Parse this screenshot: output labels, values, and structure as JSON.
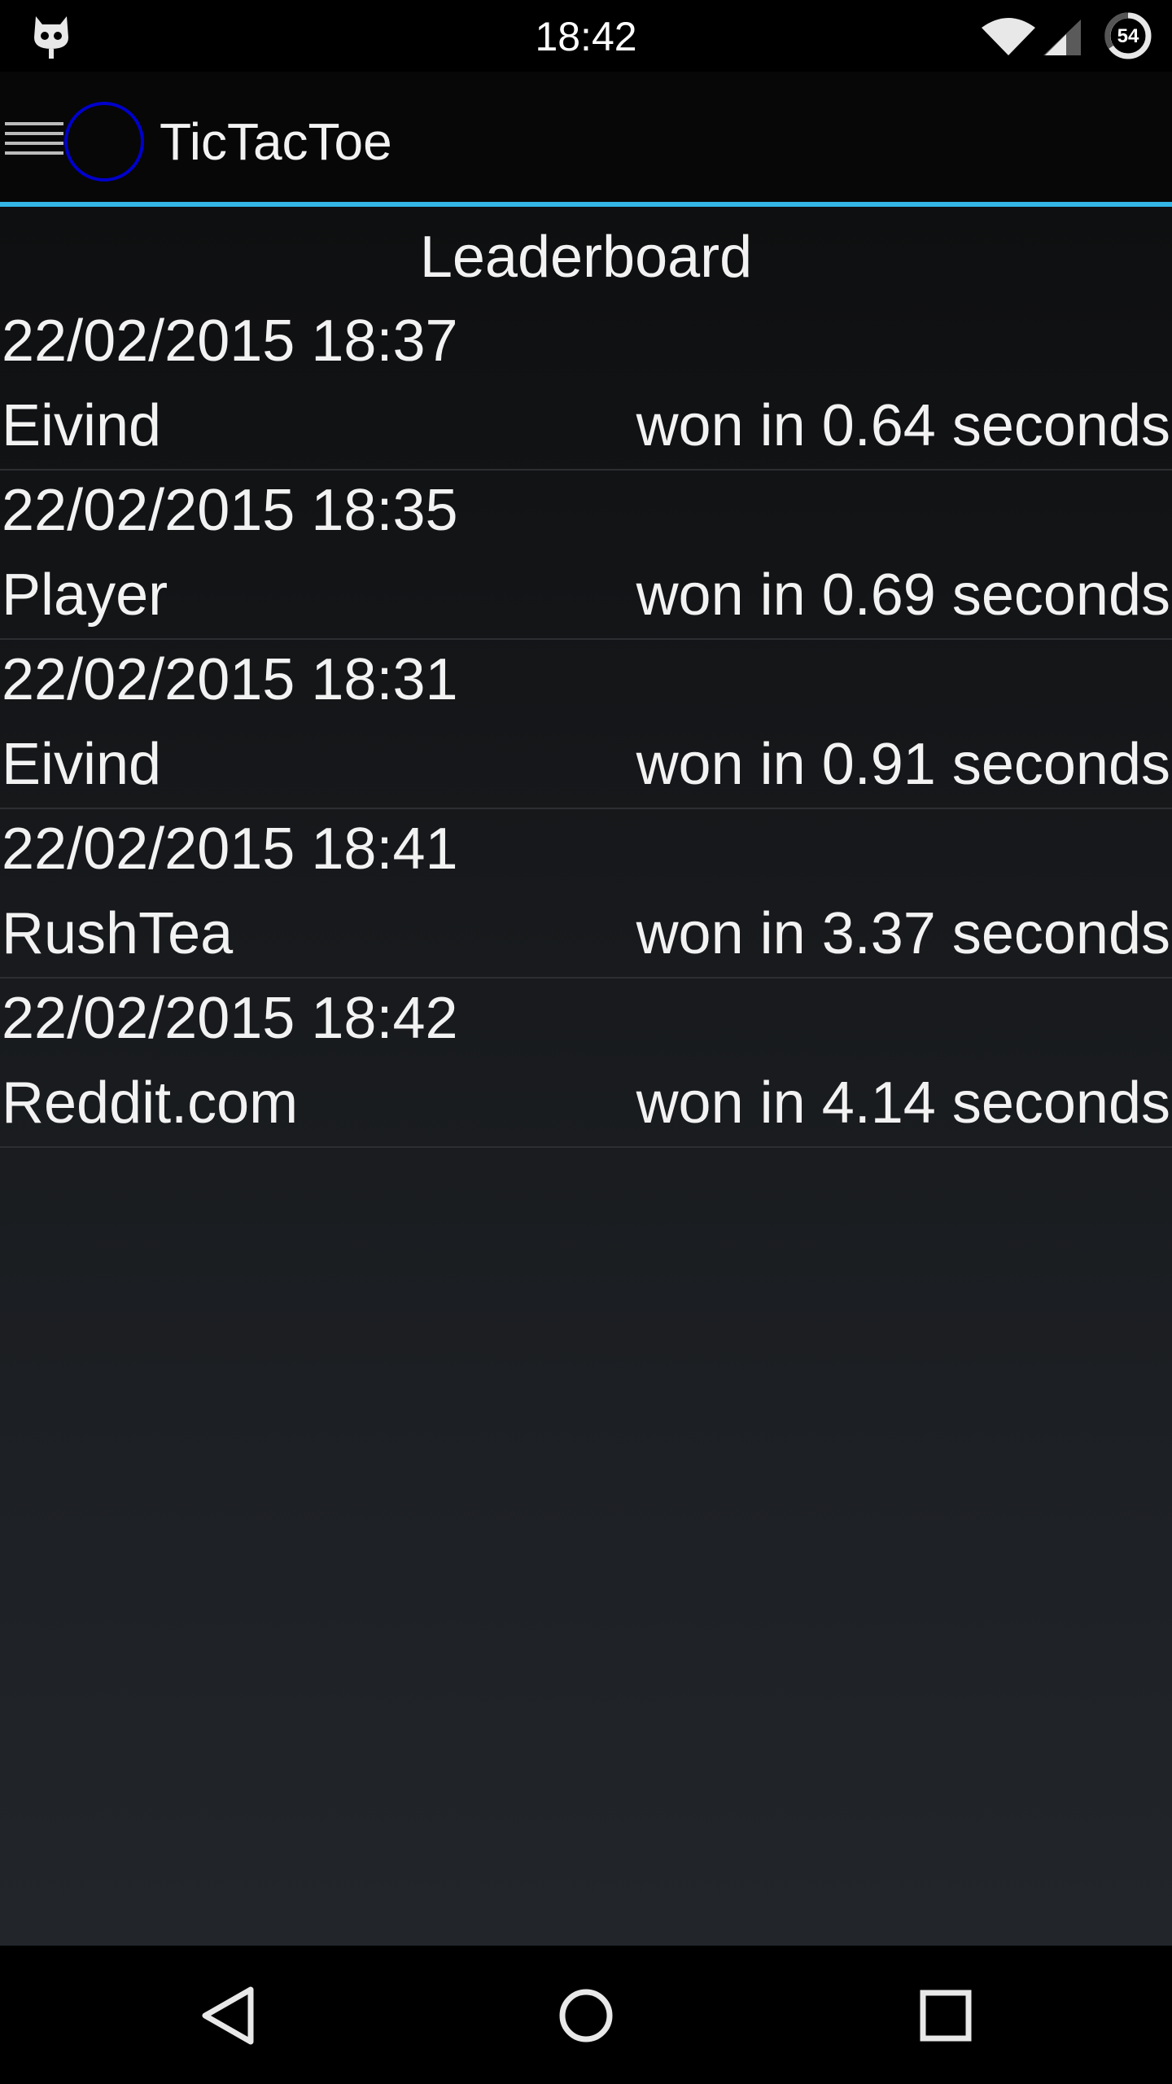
{
  "status_bar": {
    "time": "18:42",
    "battery_level": "54",
    "icons": [
      "cyanogenmod-icon",
      "wifi-icon",
      "signal-icon",
      "battery-icon"
    ]
  },
  "action_bar": {
    "title": "TicTacToe",
    "accent_color": "#33b5e5",
    "app_icon_color": "#0000cc",
    "icons": [
      "drawer-menu-icon",
      "app-circle-icon"
    ]
  },
  "leaderboard": {
    "heading": "Leaderboard",
    "entries": [
      {
        "date": "22/02/2015 18:37",
        "player": "Eivind",
        "result": "won in 0.64 seconds"
      },
      {
        "date": "22/02/2015 18:35",
        "player": "Player",
        "result": "won in 0.69 seconds"
      },
      {
        "date": "22/02/2015 18:31",
        "player": "Eivind",
        "result": "won in 0.91 seconds"
      },
      {
        "date": "22/02/2015 18:41",
        "player": "RushTea",
        "result": "won in 3.37 seconds"
      },
      {
        "date": "22/02/2015 18:42",
        "player": "Reddit.com",
        "result": "won in 4.14 seconds"
      }
    ]
  },
  "nav_bar": {
    "icons": [
      "back-icon",
      "home-icon",
      "recents-icon"
    ]
  }
}
